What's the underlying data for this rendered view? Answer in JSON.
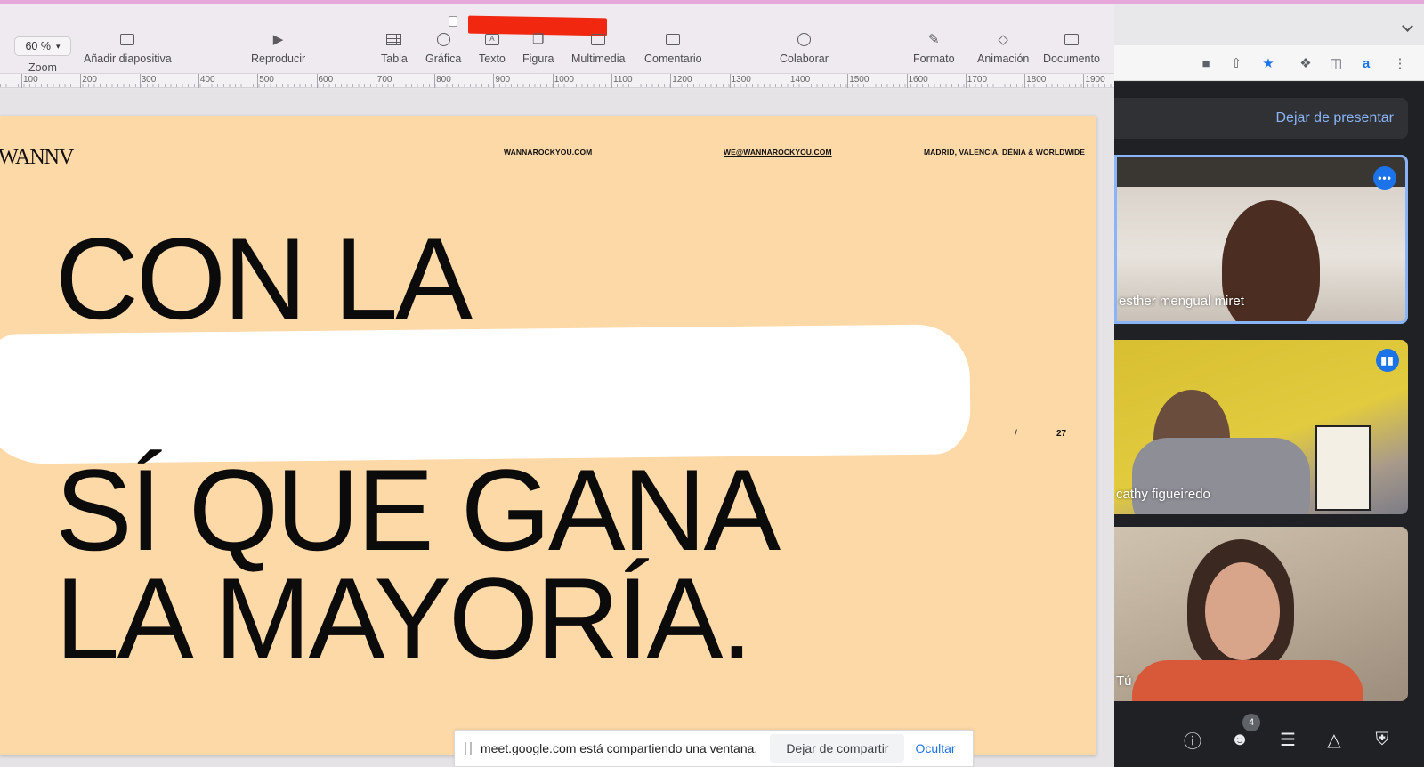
{
  "keynote": {
    "toolbar": {
      "zoom_value": "60 %",
      "zoom_label": "Zoom",
      "add_slide_label": "Añadir diapositiva",
      "play_label": "Reproducir",
      "table_label": "Tabla",
      "chart_label": "Gráfica",
      "text_label": "Texto",
      "shape_label": "Figura",
      "media_label": "Multimedia",
      "comment_label": "Comentario",
      "collaborate_label": "Colaborar",
      "format_label": "Formato",
      "animate_label": "Animación",
      "document_label": "Documento"
    },
    "ruler_ticks": [
      "100",
      "200",
      "300",
      "400",
      "500",
      "600",
      "700",
      "800",
      "900",
      "1000",
      "1100",
      "1200",
      "1300",
      "1400",
      "1500",
      "1600",
      "1700",
      "1800",
      "1900"
    ]
  },
  "slide": {
    "logo": "WANNV",
    "website": "WANNAROCKYOU.COM",
    "email": "WE@WANNAROCKYOU.COM",
    "locations": "MADRID, VALENCIA, DÉNIA & WORLDWIDE",
    "line1": "CON LA",
    "line3": "SÍ QUE GANA",
    "line4": "LA MAYORÍA.",
    "slash": "/",
    "page_number": "27",
    "background_color": "#fdd9a8"
  },
  "share_bar": {
    "message": "meet.google.com está compartiendo una ventana.",
    "stop_label": "Dejar de compartir",
    "hide_label": "Ocultar"
  },
  "meet": {
    "stop_presenting_label": "Dejar de presentar",
    "participants": [
      {
        "name": "esther mengual miret",
        "badge": "•••"
      },
      {
        "name": "cathy figueiredo",
        "badge": "▮▮"
      },
      {
        "name": "Tú",
        "badge": ""
      }
    ],
    "participant_count": "4",
    "accent_color": "#8ab4f8"
  }
}
